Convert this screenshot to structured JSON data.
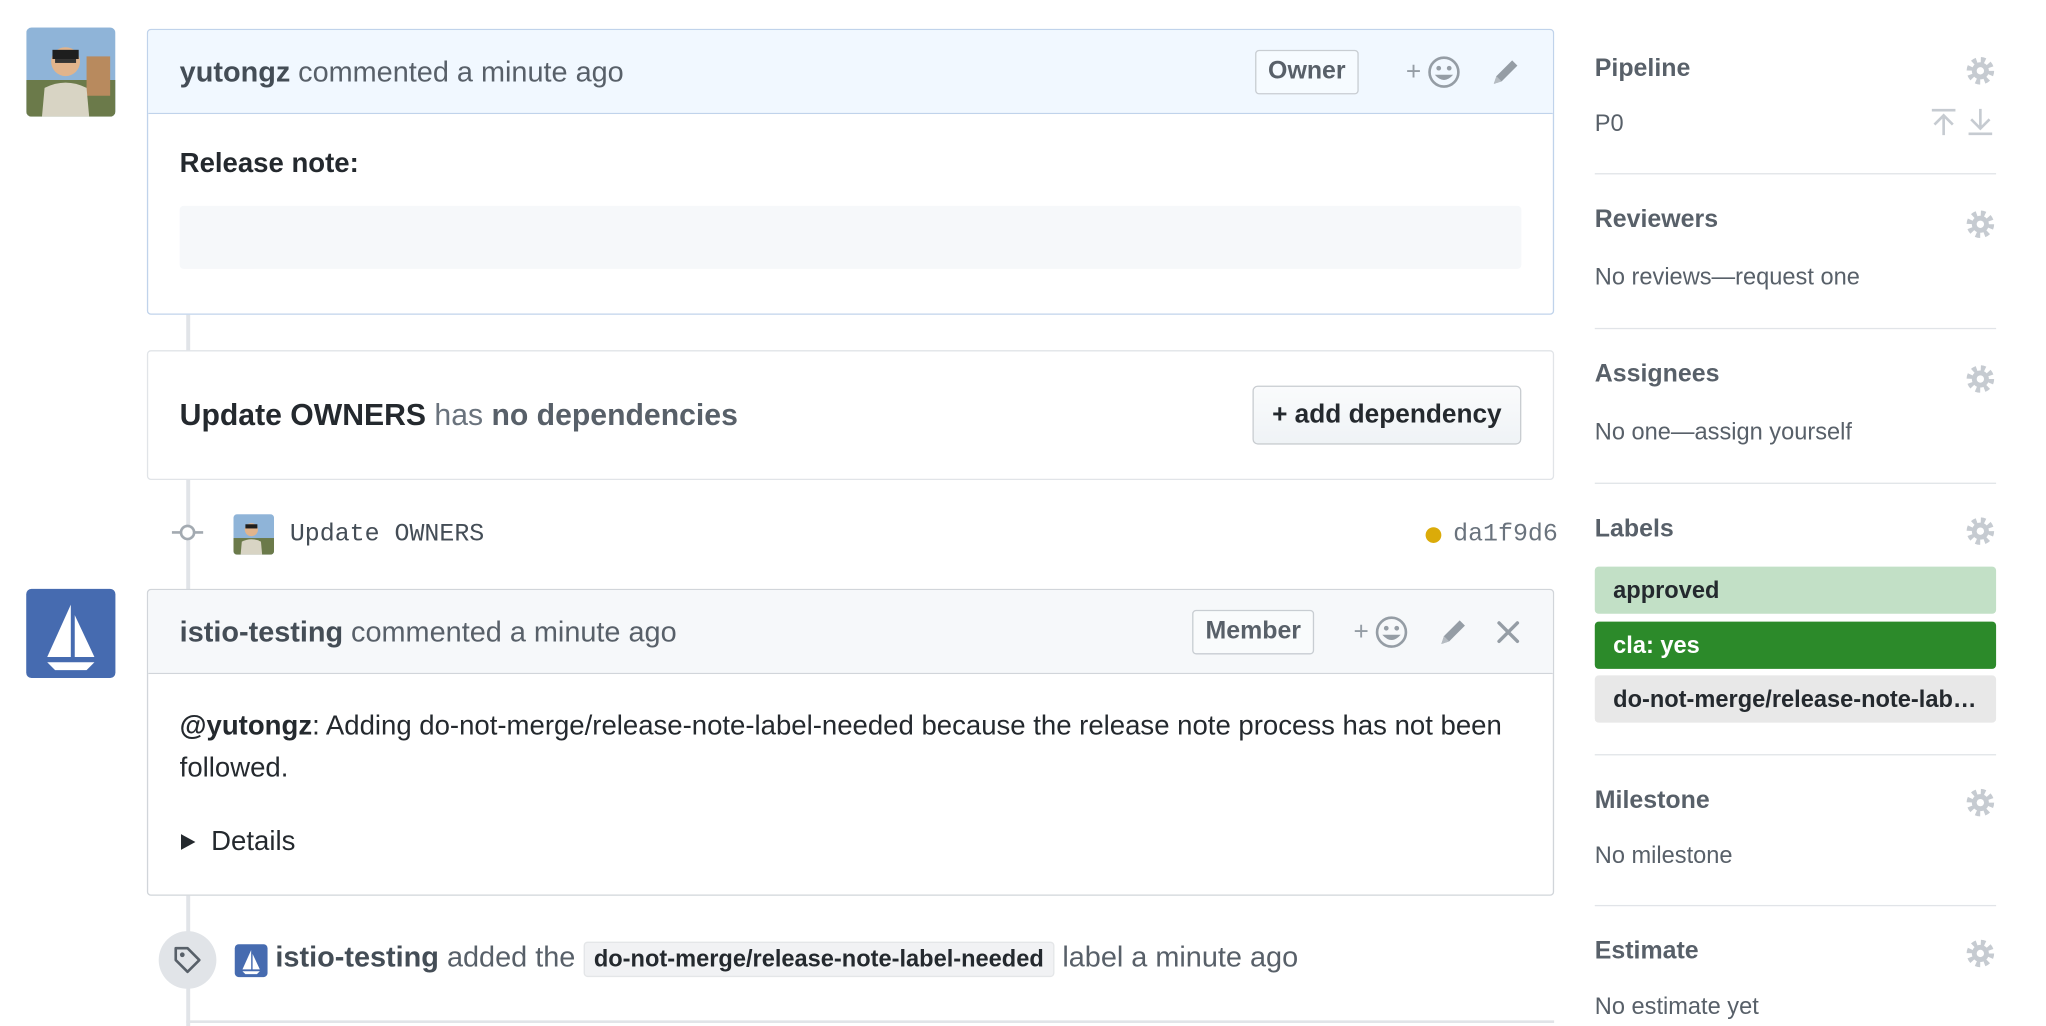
{
  "comments": [
    {
      "author": "yutongz",
      "meta": "commented a minute ago",
      "role": "Owner",
      "body_heading": "Release note:"
    },
    {
      "author": "istio-testing",
      "meta": "commented a minute ago",
      "role": "Member",
      "mention": "@yutongz",
      "body_text": ": Adding do-not-merge/release-note-label-needed because the release note process has not been followed.",
      "details_label": "Details"
    }
  ],
  "dependency": {
    "title_bold": "Update OWNERS",
    "title_has": "has",
    "title_rest": "no dependencies",
    "add_label": "+ add dependency"
  },
  "commit": {
    "message": "Update OWNERS",
    "sha": "da1f9d6",
    "status_color": "#dbab09"
  },
  "event": {
    "actor": "istio-testing",
    "action": "added the",
    "label": "do-not-merge/release-note-label-needed",
    "suffix": "label a minute ago"
  },
  "sidebar": {
    "pipeline": {
      "title": "Pipeline",
      "value": "P0"
    },
    "reviewers": {
      "title": "Reviewers",
      "value": "No reviews—request one"
    },
    "assignees": {
      "title": "Assignees",
      "value": "No one—assign yourself"
    },
    "labels": {
      "title": "Labels",
      "items": [
        {
          "name": "approved",
          "bg": "#c2e0c6",
          "fg": "#24292e"
        },
        {
          "name": "cla: yes",
          "bg": "#2c8a2a",
          "fg": "#ffffff"
        },
        {
          "name": "do-not-merge/release-note-label-needed",
          "bg": "#e8e8e8",
          "fg": "#24292e"
        }
      ]
    },
    "milestone": {
      "title": "Milestone",
      "value": "No milestone"
    },
    "estimate": {
      "title": "Estimate",
      "value": "No estimate yet"
    }
  },
  "colors": {
    "owner_header_bg": "#f1f8ff",
    "istio_blue": "#466bb0",
    "link_green": "#2c8a2a"
  }
}
